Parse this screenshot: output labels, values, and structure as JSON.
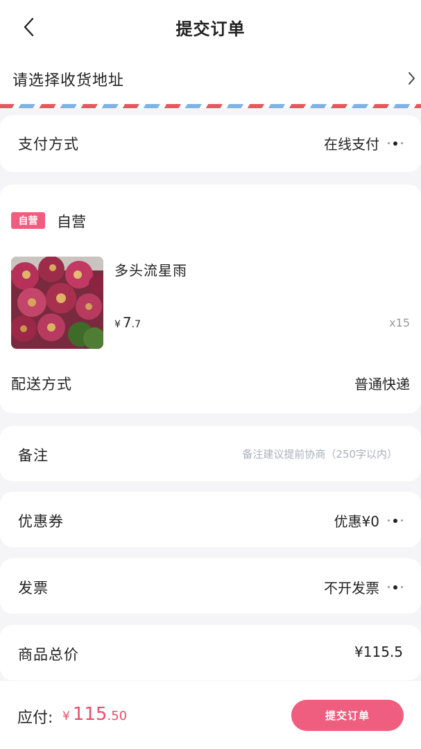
{
  "header": {
    "title": "提交订单"
  },
  "address": {
    "label": "请选择收货地址"
  },
  "payment": {
    "label": "支付方式",
    "value": "在线支付"
  },
  "store": {
    "badge": "自营",
    "name": "自营",
    "product": {
      "name": "多头流星雨",
      "price_symbol": "¥",
      "price_int": "7",
      "price_dec": ".7",
      "quantity": "x15"
    },
    "shipping": {
      "label": "配送方式",
      "value": "普通快递"
    }
  },
  "remark": {
    "label": "备注",
    "placeholder": "备注建议提前协商（250字以内）"
  },
  "coupon": {
    "label": "优惠券",
    "value": "优惠¥0"
  },
  "invoice": {
    "label": "发票",
    "value": "不开发票"
  },
  "total": {
    "label": "商品总价",
    "value": "¥115.5"
  },
  "footer": {
    "pay_label": "应付:",
    "symbol": "¥",
    "amount_int": "115",
    "amount_dec": ".50",
    "submit_label": "提交订单"
  },
  "colors": {
    "accent": "#ef5d7f",
    "price_red": "#ef4a6c",
    "airmail_red": "#e5585e",
    "airmail_blue": "#7eb3e6"
  }
}
